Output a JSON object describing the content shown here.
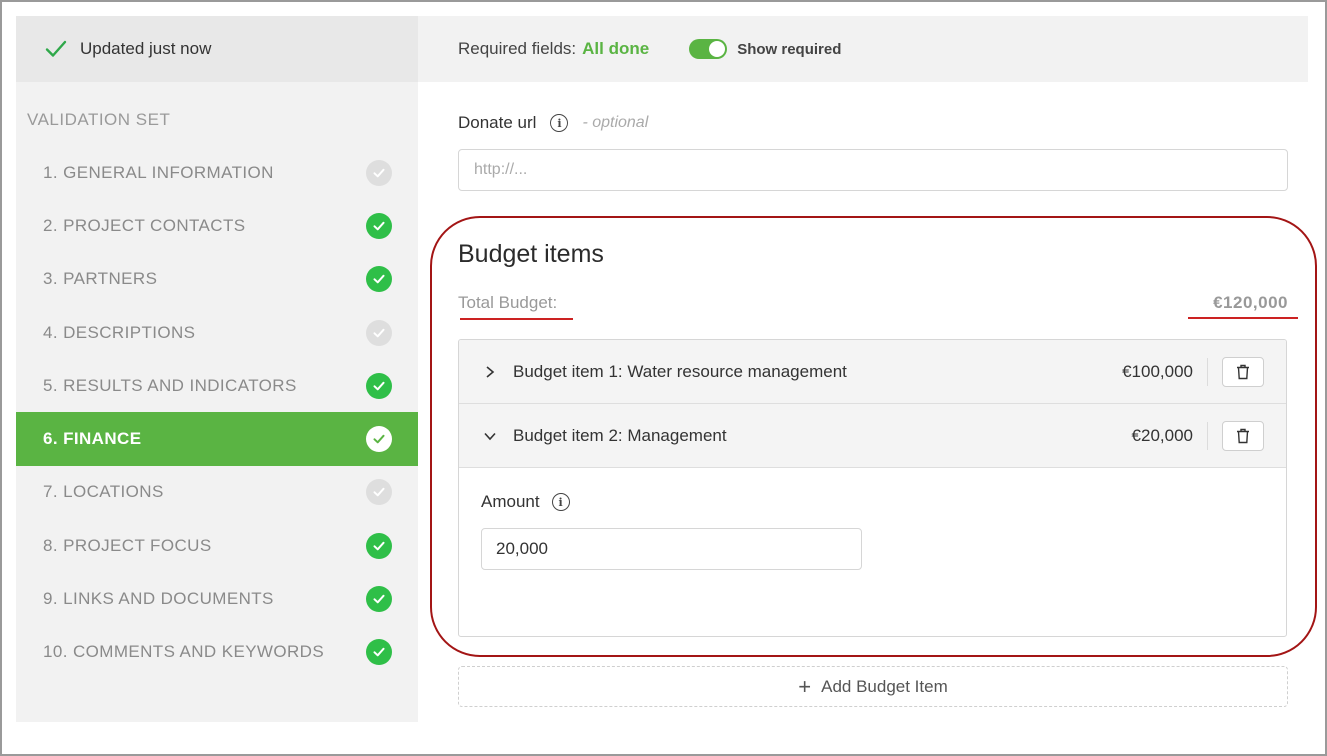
{
  "status": {
    "text": "Updated just now"
  },
  "topbar": {
    "required_label": "Required fields:",
    "required_value": "All done",
    "toggle_label": "Show required"
  },
  "sidebar": {
    "set_title": "VALIDATION SET",
    "items": [
      {
        "label": "1. GENERAL INFORMATION",
        "state": "pending"
      },
      {
        "label": "2. PROJECT CONTACTS",
        "state": "done"
      },
      {
        "label": "3. PARTNERS",
        "state": "done"
      },
      {
        "label": "4. DESCRIPTIONS",
        "state": "pending"
      },
      {
        "label": "5. RESULTS AND INDICATORS",
        "state": "done"
      },
      {
        "label": "6. FINANCE",
        "state": "active"
      },
      {
        "label": "7. LOCATIONS",
        "state": "pending"
      },
      {
        "label": "8. PROJECT FOCUS",
        "state": "done"
      },
      {
        "label": "9. LINKS AND DOCUMENTS",
        "state": "done"
      },
      {
        "label": "10. COMMENTS AND KEYWORDS",
        "state": "done"
      }
    ]
  },
  "donate": {
    "label": "Donate url",
    "optional": "- optional",
    "placeholder": "http://..."
  },
  "budget": {
    "title": "Budget items",
    "total_label": "Total Budget:",
    "total_value": "€120,000",
    "items": [
      {
        "name": "Budget item 1: Water resource management",
        "amount": "€100,000",
        "expanded": false
      },
      {
        "name": "Budget item 2: Management",
        "amount": "€20,000",
        "expanded": true
      }
    ],
    "amount_label": "Amount",
    "amount_value": "20,000",
    "add_label": "Add Budget Item"
  },
  "colors": {
    "accent": "#5ab443",
    "done": "#2fbf48",
    "annotation": "#a31515"
  }
}
